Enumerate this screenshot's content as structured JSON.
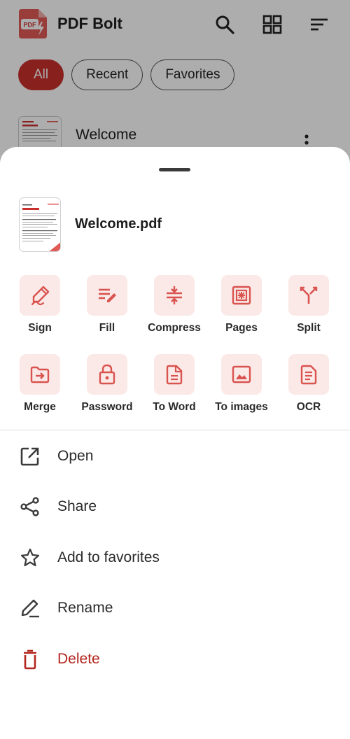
{
  "app": {
    "title": "PDF Bolt",
    "logo_text": "PDF",
    "icons": [
      "search-icon",
      "grid-view-icon",
      "sort-icon"
    ],
    "filters": [
      {
        "label": "All",
        "active": true
      },
      {
        "label": "Recent",
        "active": false
      },
      {
        "label": "Favorites",
        "active": false
      }
    ],
    "file_name": "Welcome"
  },
  "sheet": {
    "file_name": "Welcome.pdf",
    "tools": [
      {
        "label": "Sign",
        "icon": "sign-icon"
      },
      {
        "label": "Fill",
        "icon": "fill-icon"
      },
      {
        "label": "Compress",
        "icon": "compress-icon"
      },
      {
        "label": "Pages",
        "icon": "pages-icon"
      },
      {
        "label": "Split",
        "icon": "split-icon"
      },
      {
        "label": "Merge",
        "icon": "merge-icon"
      },
      {
        "label": "Password",
        "icon": "lock-icon"
      },
      {
        "label": "To Word",
        "icon": "document-icon"
      },
      {
        "label": "To images",
        "icon": "image-icon"
      },
      {
        "label": "OCR",
        "icon": "ocr-icon"
      }
    ],
    "actions": [
      {
        "label": "Open",
        "icon": "open-external-icon"
      },
      {
        "label": "Share",
        "icon": "share-icon"
      },
      {
        "label": "Add to favorites",
        "icon": "star-icon"
      },
      {
        "label": "Rename",
        "icon": "rename-icon"
      },
      {
        "label": "Delete",
        "icon": "trash-icon",
        "danger": true
      }
    ]
  },
  "colors": {
    "accent": "#c9302c",
    "tool_bg": "#fbe9e7",
    "icon_red": "#d9534f",
    "danger": "#b3261e"
  }
}
